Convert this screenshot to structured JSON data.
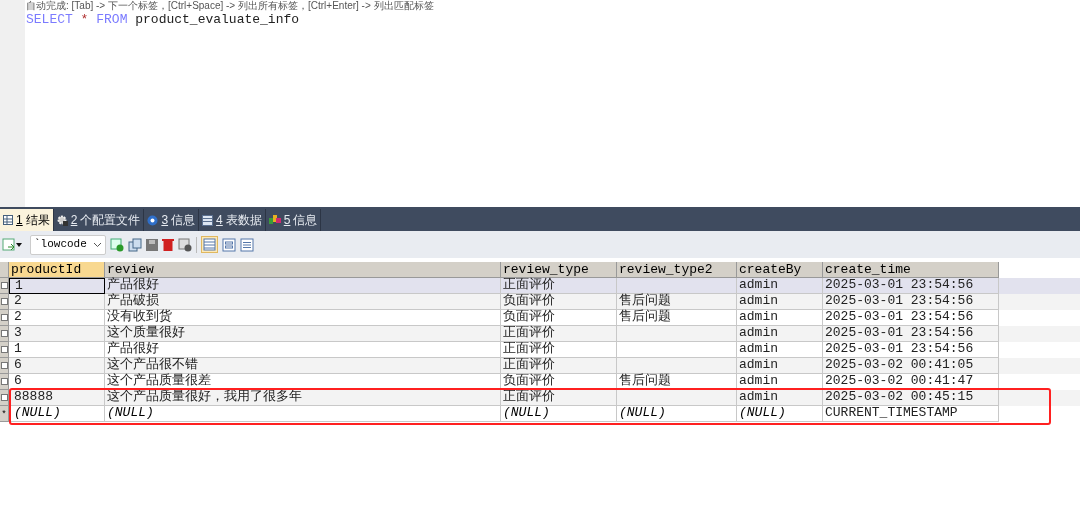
{
  "editor": {
    "hint": "自动完成: [Tab] -> 下一个标签，[Ctrl+Space] -> 列出所有标签，[Ctrl+Enter] -> 列出匹配标签",
    "sql": [
      {
        "kind": "keyword",
        "text": "SELECT"
      },
      {
        "kind": "operator",
        "text": "*"
      },
      {
        "kind": "keyword",
        "text": "FROM"
      },
      {
        "kind": "name",
        "text": "product_evaluate_info"
      }
    ]
  },
  "tabs": [
    {
      "number": "1",
      "label": "结果",
      "selected": true
    },
    {
      "number": "2",
      "label": "个配置文件",
      "selected": false
    },
    {
      "number": "3",
      "label": "信息",
      "selected": false
    },
    {
      "number": "4",
      "label": "表数据",
      "selected": false
    },
    {
      "number": "5",
      "label": "信息",
      "selected": false
    }
  ],
  "toolbar": {
    "database": "`lowcode"
  },
  "table": {
    "columns": [
      {
        "label": "productId",
        "selected": true
      },
      {
        "label": "review",
        "selected": false
      },
      {
        "label": "review_type",
        "selected": false
      },
      {
        "label": "review_type2",
        "selected": false
      },
      {
        "label": "createBy",
        "selected": false
      },
      {
        "label": "create_time",
        "selected": false
      }
    ],
    "rows": [
      {
        "kind": "data",
        "checked": false,
        "selected": true,
        "cells": [
          "1",
          "产品很好",
          "正面评价",
          "",
          "admin",
          "2025-03-01 23:54:56"
        ]
      },
      {
        "kind": "data",
        "checked": false,
        "selected": false,
        "cells": [
          "2",
          "产品破损",
          "负面评价",
          "售后问题",
          "admin",
          "2025-03-01 23:54:56"
        ]
      },
      {
        "kind": "data",
        "checked": false,
        "selected": false,
        "cells": [
          "2",
          "没有收到货",
          "负面评价",
          "售后问题",
          "admin",
          "2025-03-01 23:54:56"
        ]
      },
      {
        "kind": "data",
        "checked": false,
        "selected": false,
        "cells": [
          "3",
          "这个质量很好",
          "正面评价",
          "",
          "admin",
          "2025-03-01 23:54:56"
        ]
      },
      {
        "kind": "data",
        "checked": false,
        "selected": false,
        "cells": [
          "1",
          "产品很好",
          "正面评价",
          "",
          "admin",
          "2025-03-01 23:54:56"
        ]
      },
      {
        "kind": "data",
        "checked": false,
        "selected": false,
        "cells": [
          "6",
          "这个产品很不错",
          "正面评价",
          "",
          "admin",
          "2025-03-02 00:41:05"
        ]
      },
      {
        "kind": "data",
        "checked": false,
        "selected": false,
        "cells": [
          "6",
          "这个产品质量很差",
          "负面评价",
          "售后问题",
          "admin",
          "2025-03-02 00:41:47"
        ]
      },
      {
        "kind": "data",
        "checked": false,
        "selected": false,
        "cells": [
          "88888",
          "这个产品质量很好，我用了很多年",
          "正面评价",
          "",
          "admin",
          "2025-03-02 00:45:15"
        ]
      },
      {
        "kind": "new",
        "marker": "*",
        "selected": false,
        "cells": [
          {
            "text": "(NULL)",
            "null": true
          },
          {
            "text": "(NULL)",
            "null": true
          },
          {
            "text": "(NULL)",
            "null": true
          },
          {
            "text": "(NULL)",
            "null": true
          },
          {
            "text": "(NULL)",
            "null": true
          },
          {
            "text": "CURRENT_TIMESTAMP",
            "null": false
          }
        ]
      }
    ]
  }
}
